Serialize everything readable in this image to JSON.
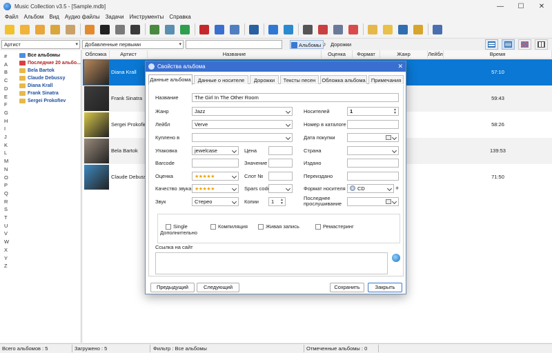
{
  "window": {
    "title": "Music Collection v3.5 - [Sample.mdb]",
    "minimize": "—",
    "maximize": "☐",
    "close": "✕"
  },
  "menu": [
    "Файл",
    "Альбом",
    "Вид",
    "Аудио файлы",
    "Задачи",
    "Инструменты",
    "Справка"
  ],
  "toolbar_icons": [
    {
      "name": "add-album-icon",
      "color": "#f2c12e"
    },
    {
      "name": "add-folder-icon",
      "color": "#f0b43a"
    },
    {
      "name": "edit-icon",
      "color": "#e9a63b"
    },
    {
      "name": "copy-icon",
      "color": "#d9a63c"
    },
    {
      "name": "delete-icon",
      "color": "#c9a26a"
    },
    {
      "name": "eject-icon",
      "color": "#e38a2e"
    },
    {
      "name": "record-icon",
      "color": "#222222"
    },
    {
      "name": "import-icon",
      "color": "#7a7a7a"
    },
    {
      "name": "disc-icon",
      "color": "#3a3a3a"
    },
    {
      "name": "search-icon",
      "color": "#4a8a40"
    },
    {
      "name": "binoculars-icon",
      "color": "#5a8fb0"
    },
    {
      "name": "web-icon",
      "color": "#2f9e4f"
    },
    {
      "name": "stop-icon",
      "color": "#c4282c"
    },
    {
      "name": "pencil-icon",
      "color": "#3a6fcf"
    },
    {
      "name": "scan-icon",
      "color": "#4f7fc0"
    },
    {
      "name": "zoom-icon",
      "color": "#2a5fa0"
    },
    {
      "name": "play-icon",
      "color": "#2f78d4"
    },
    {
      "name": "shuffle-icon",
      "color": "#2a8ad0"
    },
    {
      "name": "print-icon",
      "color": "#555555"
    },
    {
      "name": "calendar-icon",
      "color": "#c94040"
    },
    {
      "name": "report-icon",
      "color": "#6a7a9a"
    },
    {
      "name": "pie-chart-icon",
      "color": "#d94a4a"
    },
    {
      "name": "notes-icon",
      "color": "#e6b84a"
    },
    {
      "name": "lock-icon",
      "color": "#e8c04a"
    },
    {
      "name": "user-icon",
      "color": "#2f6fb0"
    },
    {
      "name": "lend-icon",
      "color": "#d7a52c"
    },
    {
      "name": "exit-icon",
      "color": "#4a6fb0"
    }
  ],
  "filter": {
    "field": "Артист",
    "sort": "Добавленные первыми",
    "search": "",
    "tab_albums": "Альбомы",
    "tab_tracks": "Дорожки"
  },
  "alphabet": [
    "#",
    "A",
    "B",
    "C",
    "D",
    "E",
    "F",
    "G",
    "H",
    "I",
    "J",
    "K",
    "L",
    "M",
    "N",
    "O",
    "P",
    "Q",
    "R",
    "S",
    "T",
    "U",
    "V",
    "W",
    "X",
    "Y",
    "Z"
  ],
  "tree": [
    {
      "label": "Все альбомы",
      "kind": "blue"
    },
    {
      "label": "Последние 20 альбо...",
      "kind": "red"
    },
    {
      "label": "Bela Bartok",
      "kind": "folder"
    },
    {
      "label": "Claude Debussy",
      "kind": "folder"
    },
    {
      "label": "Diana Krall",
      "kind": "folder"
    },
    {
      "label": "Frank Sinatra",
      "kind": "folder"
    },
    {
      "label": "Sergei Prokofiev",
      "kind": "folder"
    }
  ],
  "columns": [
    "Обложка",
    "Артист",
    "Название",
    "Оценка",
    "Формат",
    "Жанр",
    "Лейбл",
    "Время"
  ],
  "albums": [
    {
      "artist": "Diana Krall",
      "time": "57:10",
      "cover": "#b8875a",
      "selected": true
    },
    {
      "artist": "Frank Sinatra",
      "time": "59:43",
      "cover": "#3d3d3d",
      "selected": false
    },
    {
      "artist": "Sergei Prokofiev",
      "time": "58:26",
      "cover": "#d7c64a",
      "selected": false
    },
    {
      "artist": "Bela Bartok",
      "time": "139:53",
      "cover": "#9a8a7a",
      "selected": false
    },
    {
      "artist": "Claude Debussy",
      "time": "71:50",
      "cover": "#3f8ac0",
      "selected": false
    }
  ],
  "status": {
    "total": "Всего альбомов : 5",
    "loaded": "Загружено : 5",
    "filter": "Фильтр : Все альбомы",
    "marked": "Отмеченные альбомы : 0"
  },
  "dialog": {
    "title": "Свойства альбома",
    "close": "✕",
    "tabs": [
      "Данные альбома",
      "Данные о носителе",
      "Дорожки",
      "Тексты песен",
      "Обложка альбома",
      "Примечания"
    ],
    "labels": {
      "name": "Название",
      "genre": "Жанр",
      "label": "Лейбл",
      "bought_in": "Куплено в",
      "package": "Упаковка",
      "barcode": "Barcode",
      "rating": "Оценка",
      "sound_quality": "Качество звука",
      "sound": "Звук",
      "price": "Цена",
      "value": "Значение",
      "slot": "Слот №",
      "spars": "Spars code",
      "copies": "Копии",
      "media": "Носителей",
      "catalog": "Номер в каталоге",
      "purchase_date": "Дата покупки",
      "country": "Страна",
      "published": "Издано",
      "reissued": "Переиздано",
      "media_format": "Формат носителя",
      "last_played": "Последнее прослушивание",
      "extra": "Дополнительно",
      "url": "Ссылка на сайт"
    },
    "values": {
      "name": "The Girl In The Other Room",
      "genre": "Jazz",
      "label": "Verve",
      "package": "jewelcase",
      "sound": "Стерео",
      "copies": "1",
      "media": "1",
      "media_format": "CD",
      "stars": "★★★★★"
    },
    "checkboxes": [
      "Single",
      "Компиляция",
      "Живая запись",
      "Ремастеринг"
    ],
    "buttons": {
      "prev": "Предыдущий",
      "next": "Следующий",
      "save": "Сохранить",
      "close": "Закрыть"
    }
  }
}
